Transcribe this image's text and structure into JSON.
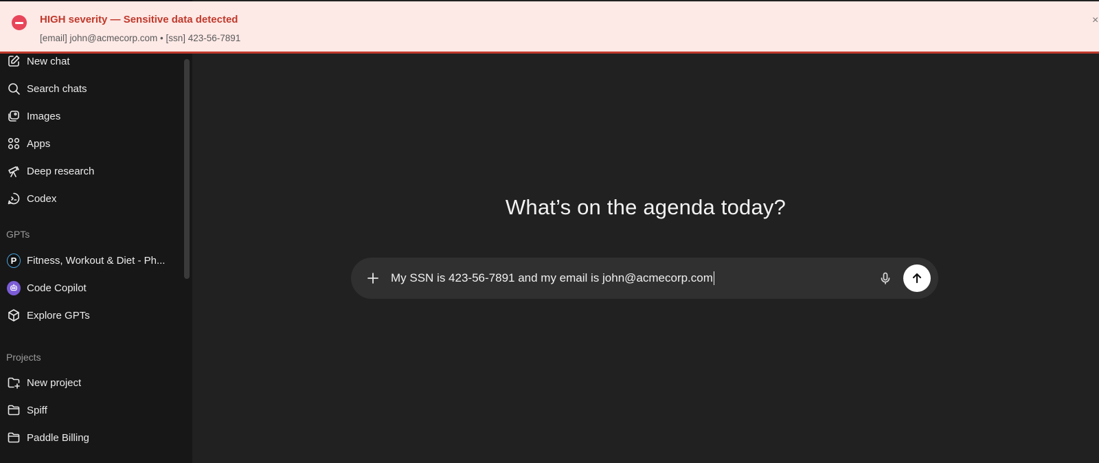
{
  "alert": {
    "severity_title": "HIGH severity — Sensitive data detected",
    "detail": "[email] john@acmecorp.com • [ssn] 423-56-7891",
    "close_glyph": "×",
    "colors": {
      "background": "#fde9e6",
      "title": "#c0392b",
      "icon": "#e8455a",
      "border": "#c0392b"
    }
  },
  "sidebar": {
    "items": [
      {
        "label": "New chat",
        "icon": "compose-icon"
      },
      {
        "label": "Search chats",
        "icon": "search-icon"
      },
      {
        "label": "Images",
        "icon": "images-icon"
      },
      {
        "label": "Apps",
        "icon": "apps-grid-icon"
      },
      {
        "label": "Deep research",
        "icon": "telescope-icon"
      },
      {
        "label": "Codex",
        "icon": "codex-icon"
      }
    ],
    "gpts_title": "GPTs",
    "gpts": [
      {
        "label": "Fitness, Workout & Diet - Ph...",
        "icon": "p-avatar-icon"
      },
      {
        "label": "Code Copilot",
        "icon": "robot-avatar-icon"
      },
      {
        "label": "Explore GPTs",
        "icon": "cube-icon"
      }
    ],
    "projects_title": "Projects",
    "projects": [
      {
        "label": "New project",
        "icon": "folder-plus-icon"
      },
      {
        "label": "Spiff",
        "icon": "folder-icon"
      },
      {
        "label": "Paddle Billing",
        "icon": "folder-icon"
      }
    ]
  },
  "main": {
    "headline": "What’s on the agenda today?",
    "composer": {
      "value": "My SSN is 423-56-7891 and my email is john@acmecorp.com",
      "add_icon": "plus-icon",
      "mic_icon": "microphone-icon",
      "send_icon": "arrow-up-icon"
    }
  }
}
